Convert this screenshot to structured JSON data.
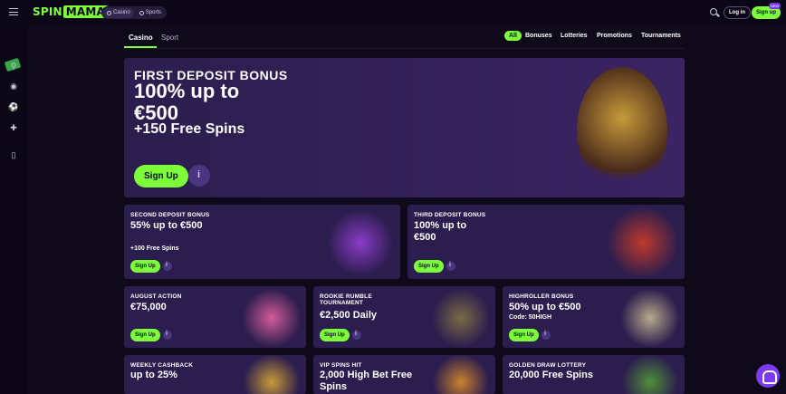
{
  "brand": {
    "name_part1": "SPIN",
    "name_part2": "MAMA",
    "accent": "#7cff3a"
  },
  "topbar": {
    "switch": [
      {
        "label": "Casino",
        "icon": "casino-icon"
      },
      {
        "label": "Sports",
        "icon": "sports-icon"
      }
    ],
    "login_label": "Log in",
    "signup_label": "Sign up",
    "new_badge": "NEW"
  },
  "sidebar": {
    "icons": [
      "bonus-icon",
      "bike-icon",
      "live-icon",
      "soccer-icon",
      "gamepad-icon",
      "phone-icon"
    ]
  },
  "categories": {
    "casino": "Casino",
    "sport": "Sport"
  },
  "filters": {
    "all": "All",
    "bonuses": "Bonuses",
    "lotteries": "Lotteries",
    "promotions": "Promotions",
    "tournaments": "Tournaments"
  },
  "hero": {
    "t1": "FIRST DEPOSIT BONUS",
    "t2": "100% up to €500",
    "t3": "+150 Free Spins",
    "button": "Sign Up"
  },
  "cards": {
    "second": {
      "t1": "SECOND DEPOSIT BONUS",
      "t2": "55% up to €500",
      "t3": "+100 Free Spins",
      "button": "Sign Up"
    },
    "third": {
      "t1": "THIRD DEPOSIT BONUS",
      "t2": "100% up to €500",
      "button": "Sign Up"
    },
    "august": {
      "t1": "AUGUST ACTION",
      "t2": "€75,000",
      "button": "Sign Up"
    },
    "rookie": {
      "t1": "ROOKIE RUMBLE TOURNAMENT",
      "t2": "€2,500 Daily",
      "button": "Sign Up"
    },
    "highroller": {
      "t1": "HIGHROLLER BONUS",
      "t2": "50% up to €500",
      "t3": "Code: 50HIGH",
      "button": "Sign Up"
    },
    "weekly": {
      "t1": "WEEKLY CASHBACK",
      "t2": "up to 25%"
    },
    "vip": {
      "t1": "VIP SPINS HIT",
      "t2": "2,000 High Bet Free Spins"
    },
    "golden": {
      "t1": "GOLDEN DRAW LOTTERY",
      "t2": "20,000 Free Spins"
    }
  }
}
